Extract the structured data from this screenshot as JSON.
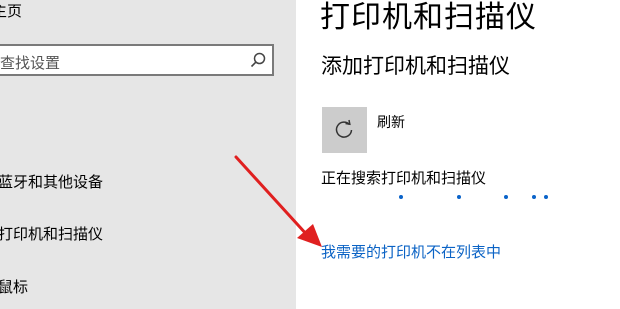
{
  "sidebar": {
    "home_label": "主页",
    "search": {
      "placeholder": "查找设置"
    },
    "items": [
      {
        "label": "蓝牙和其他设备"
      },
      {
        "label": "打印机和扫描仪"
      },
      {
        "label": "鼠标"
      }
    ]
  },
  "main": {
    "title": "打印机和扫描仪",
    "section_title": "添加打印机和扫描仪",
    "refresh_label": "刷新",
    "searching_text": "正在搜索打印机和扫描仪",
    "link_text": "我需要的打印机不在列表中"
  },
  "colors": {
    "sidebar_bg": "#e6e6e6",
    "link": "#0b63c5",
    "arrow": "#e02020",
    "refresh_button_bg": "#cccccc"
  },
  "icons": {
    "search": "search-icon",
    "refresh": "refresh-icon"
  }
}
